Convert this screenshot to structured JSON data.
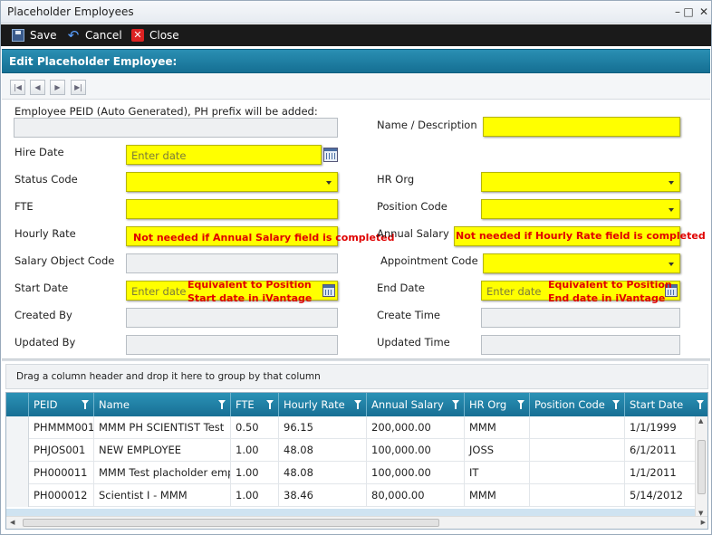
{
  "window": {
    "title": "Placeholder Employees"
  },
  "toolbar": {
    "save": "Save",
    "cancel": "Cancel",
    "close": "Close"
  },
  "form_header": "Edit Placeholder Employee:",
  "form": {
    "peid_label": "Employee PEID (Auto Generated), PH prefix will be added:",
    "name_label": "Name / Description",
    "hire_date_label": "Hire Date",
    "hire_date_placeholder": "Enter date",
    "status_code_label": "Status Code",
    "hr_org_label": "HR Org",
    "fte_label": "FTE",
    "position_code_label": "Position Code",
    "hourly_rate_label": "Hourly Rate",
    "hourly_rate_note": "Not needed if Annual Salary field is completed",
    "annual_salary_label": "Annual Salary",
    "annual_salary_note": "Not needed if Hourly Rate field is completed",
    "salary_object_code_label": "Salary Object Code",
    "appointment_code_label": "Appointment Code",
    "start_date_label": "Start Date",
    "start_date_placeholder": "Enter date",
    "start_date_note_1": "Equivalent to Position",
    "start_date_note_2": "Start date in iVantage",
    "end_date_label": "End Date",
    "end_date_placeholder": "Enter date",
    "end_date_note_1": "Equivalent to Position",
    "end_date_note_2": "End date in iVantage",
    "created_by_label": "Created By",
    "create_time_label": "Create Time",
    "updated_by_label": "Updated By",
    "updated_time_label": "Updated Time"
  },
  "grid": {
    "group_hint": "Drag a column header and drop it here to group by that column",
    "columns": [
      "PEID",
      "Name",
      "FTE",
      "Hourly Rate",
      "Annual Salary",
      "HR Org",
      "Position Code",
      "Start Date"
    ],
    "rows": [
      [
        "PHMMM001",
        "MMM PH SCIENTIST Test",
        "0.50",
        "96.15",
        "200,000.00",
        "MMM",
        "",
        "1/1/1999"
      ],
      [
        "PHJOS001",
        "NEW EMPLOYEE",
        "1.00",
        "48.08",
        "100,000.00",
        "JOSS",
        "",
        "6/1/2011"
      ],
      [
        "PH000011",
        "MMM Test placholder emp",
        "1.00",
        "48.08",
        "100,000.00",
        "IT",
        "",
        "1/1/2011"
      ],
      [
        "PH000012",
        "Scientist I - MMM",
        "1.00",
        "38.46",
        "80,000.00",
        "MMM",
        "",
        "5/14/2012"
      ]
    ]
  },
  "colors": {
    "header_blue": "#1a7fa6",
    "required_yellow": "#ffff00",
    "note_red": "#e00000"
  }
}
